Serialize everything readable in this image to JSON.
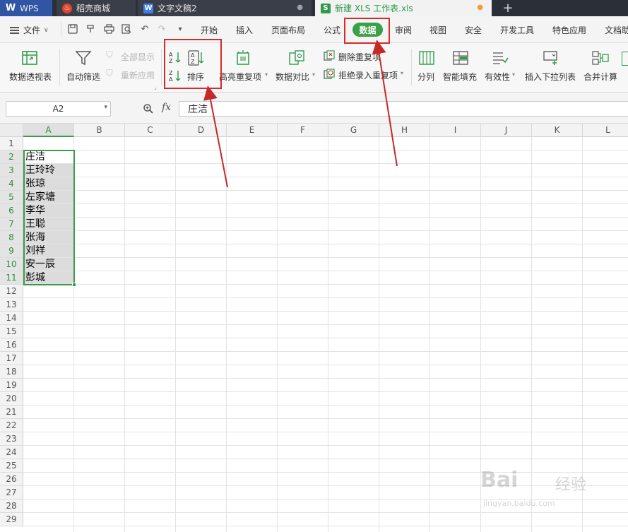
{
  "tabs": [
    {
      "label": "WPS",
      "icon": "wps-logo-icon"
    },
    {
      "label": "稻壳商城",
      "icon": "daoke-flame-icon"
    },
    {
      "label": "文字文稿2",
      "icon": "writer-doc-icon"
    },
    {
      "label": "新建 XLS 工作表.xls",
      "icon": "spreadsheet-icon"
    }
  ],
  "new_tab": "+",
  "menu": {
    "file": "文件",
    "items": [
      "开始",
      "插入",
      "页面布局",
      "公式",
      "数据",
      "审阅",
      "视图",
      "安全",
      "开发工具",
      "特色应用",
      "文档助"
    ],
    "active": "数据"
  },
  "ribbon": {
    "pivot": "数据透视表",
    "autofilter": "自动筛选",
    "show_all": "全部显示",
    "reapply": "重新应用",
    "sort": "排序",
    "highlight_dup": "高亮重复项",
    "data_compare": "数据对比",
    "remove_dup": "删除重复项",
    "reject_dup": "拒绝录入重复项",
    "split": "分列",
    "smart_fill": "智能填充",
    "validity": "有效性",
    "insert_dropdown": "插入下拉列表",
    "consolidate": "合并计算"
  },
  "formula_bar": {
    "name_box": "A2",
    "fx": "fx",
    "value": "庄洁"
  },
  "grid": {
    "columns": [
      "A",
      "B",
      "C",
      "D",
      "E",
      "F",
      "G",
      "H",
      "I",
      "J",
      "K",
      "L"
    ],
    "rows": [
      "1",
      "2",
      "3",
      "4",
      "5",
      "6",
      "7",
      "8",
      "9",
      "10",
      "11",
      "12",
      "13",
      "14",
      "15",
      "16",
      "17",
      "18",
      "19",
      "20",
      "21",
      "22",
      "23",
      "24",
      "25",
      "26",
      "27",
      "28",
      "29"
    ],
    "column_a": [
      "",
      "庄洁",
      "王玲玲",
      "张琼",
      "左家塘",
      "李华",
      "王聪",
      "张海",
      "刘祥",
      "安一辰",
      "彭城"
    ]
  },
  "watermark": {
    "brand": "Bai",
    "brand2": "经验",
    "url": "jingyan.baidu.com"
  },
  "colors": {
    "accent": "#3aa04a",
    "annotation": "#d62b2b",
    "titlebar": "#2b2f38"
  }
}
